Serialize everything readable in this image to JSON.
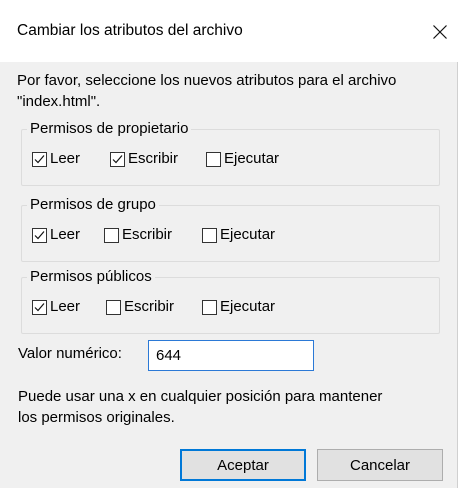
{
  "window": {
    "title": "Cambiar los atributos del archivo",
    "close_icon": "close-icon"
  },
  "intro": {
    "line1": "Por favor, seleccione los nuevos atributos para el archivo",
    "line2": "\"index.html\"."
  },
  "groups": [
    {
      "legend": "Permisos de propietario",
      "checkboxes": [
        {
          "label": "Leer",
          "checked": true
        },
        {
          "label": "Escribir",
          "checked": true
        },
        {
          "label": "Ejecutar",
          "checked": false
        }
      ]
    },
    {
      "legend": "Permisos de grupo",
      "checkboxes": [
        {
          "label": "Leer",
          "checked": true
        },
        {
          "label": "Escribir",
          "checked": false
        },
        {
          "label": "Ejecutar",
          "checked": false
        }
      ]
    },
    {
      "legend": "Permisos públicos",
      "checkboxes": [
        {
          "label": "Leer",
          "checked": true
        },
        {
          "label": "Escribir",
          "checked": false
        },
        {
          "label": "Ejecutar",
          "checked": false
        }
      ]
    }
  ],
  "numeric": {
    "label": "Valor numérico:",
    "value": "644"
  },
  "hint": {
    "line1": "Puede usar una x en cualquier posición para mantener",
    "line2": "los permisos originales."
  },
  "buttons": {
    "ok": "Aceptar",
    "cancel": "Cancelar"
  }
}
